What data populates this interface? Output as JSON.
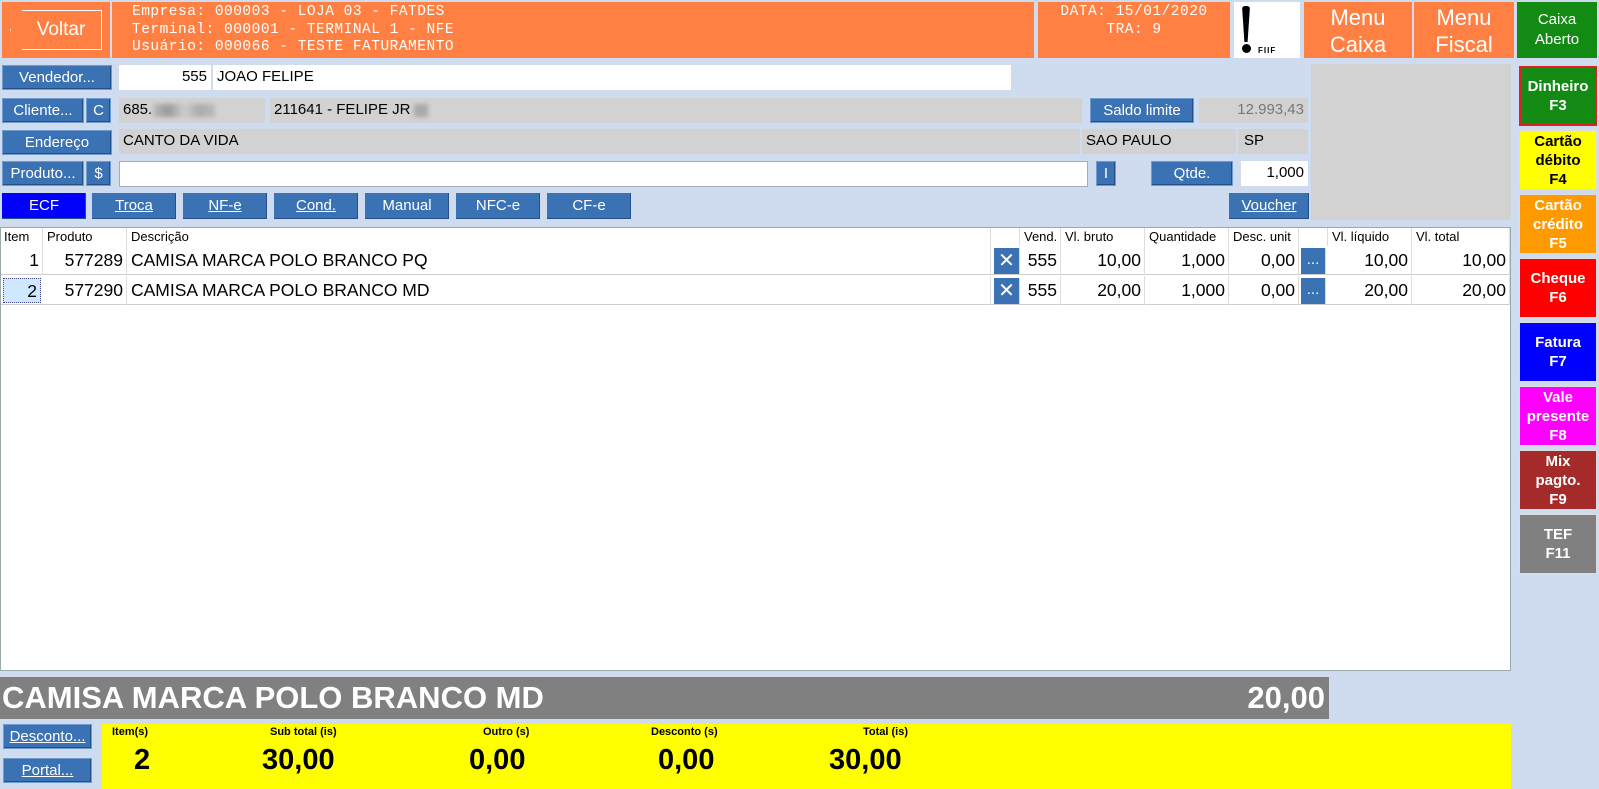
{
  "header": {
    "back_label": "Voltar",
    "empresa": "Empresa: 000003 - LOJA 03 - FATDES",
    "terminal": "Terminal: 000001 - TERMINAL 1 - NFE",
    "usuario": "Usuário: 000066 - TESTE FATURAMENTO",
    "data": "DATA: 15/01/2020",
    "tra": "TRA: 9",
    "fiscal_label": "FIIF",
    "menu_caixa_1": "Menu",
    "menu_caixa_2": "Caixa",
    "menu_fiscal_1": "Menu",
    "menu_fiscal_2": "Fiscal",
    "caixa_1": "Caixa",
    "caixa_2": "Aberto"
  },
  "form": {
    "vendedor_label": "Vendedor...",
    "vendedor_code": "555",
    "vendedor_name": "JOAO FELIPE",
    "cliente_label": "Cliente...",
    "cliente_c": "C",
    "cliente_doc": "685.",
    "cliente_name": "211641 - FELIPE JR",
    "saldo_label": "Saldo limite",
    "saldo_value": "12.993,43",
    "endereco_label": "Endereço",
    "endereco": "CANTO DA VIDA",
    "cidade": "SAO PAULO",
    "uf": "SP",
    "produto_label": "Produto...",
    "produto_dollar": "$",
    "produto_value": "",
    "i_label": "I",
    "qtde_label": "Qtde.",
    "qtde_value": "1,000"
  },
  "modes": {
    "ecf": "ECF",
    "troca": "Troca",
    "nfe": "NF-e",
    "cond": "Cond.",
    "manual": "Manual",
    "nfce": "NFC-e",
    "cfe": "CF-e",
    "voucher": "Voucher"
  },
  "table": {
    "headers": [
      "Item",
      "Produto",
      "Descrição",
      "",
      "Vend.",
      "Vl. bruto",
      "Quantidade",
      "Desc. unit",
      "",
      "Vl. líquido",
      "Vl. total"
    ],
    "rows": [
      {
        "item": "1",
        "produto": "577289",
        "descricao": "CAMISA MARCA POLO BRANCO PQ",
        "x": "✕",
        "vend": "555",
        "bruto": "10,00",
        "qtd": "1,000",
        "desc": "0,00",
        "dots": "...",
        "liquido": "10,00",
        "total": "10,00"
      },
      {
        "item": "2",
        "produto": "577290",
        "descricao": "CAMISA MARCA POLO BRANCO MD",
        "x": "✕",
        "vend": "555",
        "bruto": "20,00",
        "qtd": "1,000",
        "desc": "0,00",
        "dots": "...",
        "liquido": "20,00",
        "total": "20,00"
      }
    ]
  },
  "payments": {
    "dinheiro_1": "Dinheiro",
    "dinheiro_2": "F3",
    "debito_1": "Cartão",
    "debito_2": "débito",
    "debito_3": "F4",
    "credito_1": "Cartão",
    "credito_2": "crédito",
    "credito_3": "F5",
    "cheque_1": "Cheque",
    "cheque_2": "F6",
    "fatura_1": "Fatura",
    "fatura_2": "F7",
    "vale_1": "Vale",
    "vale_2": "presente",
    "vale_3": "F8",
    "mix_1": "Mix",
    "mix_2": "pagto.",
    "mix_3": "F9",
    "tef_1": "TEF",
    "tef_2": "F11"
  },
  "current_item": {
    "descricao": "CAMISA MARCA POLO BRANCO MD",
    "valor": "20,00"
  },
  "bottom": {
    "desconto_label": "Desconto...",
    "portal_label": "Portal..."
  },
  "totals": {
    "itens_label": "Item(s)",
    "itens_value": "2",
    "subtotal_label": "Sub total (is)",
    "subtotal_value": "30,00",
    "outro_label": "Outro (s)",
    "outro_value": "0,00",
    "desconto_label": "Desconto (s)",
    "desconto_value": "0,00",
    "total_label": "Total (is)",
    "total_value": "30,00"
  },
  "colors": {
    "header_orange": "#ff8042",
    "button_blue": "#3b72b4",
    "caixa_green": "#138a13",
    "totals_yellow": "#ffff00"
  }
}
